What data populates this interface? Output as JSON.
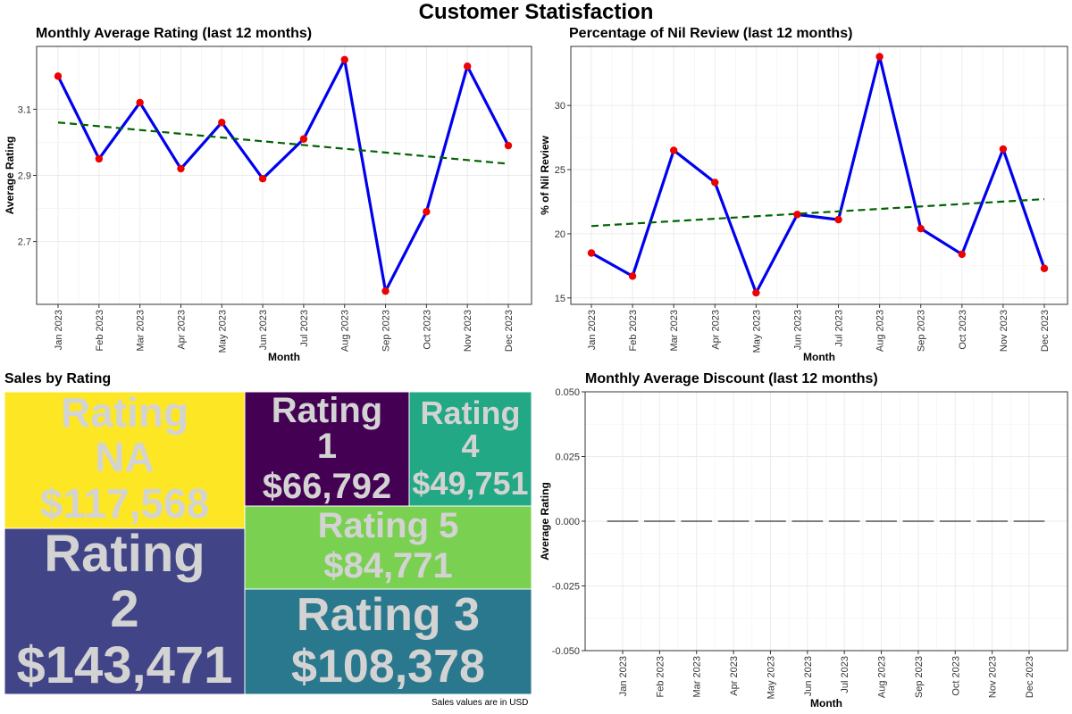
{
  "title": "Customer Statisfaction",
  "treemap_note": "Sales values are in USD",
  "colors": {
    "line": "#0000ee",
    "points": "#ee0000",
    "trend": "#006400",
    "discount": "#333333"
  },
  "chart_data": [
    {
      "id": "rating",
      "type": "line",
      "title": "Monthly Average Rating (last 12 months)",
      "xlabel": "Month",
      "ylabel": "Average Rating",
      "categories": [
        "Jan 2023",
        "Feb 2023",
        "Mar 2023",
        "Apr 2023",
        "May 2023",
        "Jun 2023",
        "Jul 2023",
        "Aug 2023",
        "Sep 2023",
        "Oct 2023",
        "Nov 2023",
        "Dec 2023"
      ],
      "series": [
        {
          "values": [
            3.2,
            2.95,
            3.12,
            2.92,
            3.06,
            2.89,
            3.01,
            3.25,
            2.55,
            2.79,
            3.23,
            2.99
          ]
        }
      ],
      "trend": [
        3.06,
        2.935
      ],
      "ylim": [
        2.51,
        3.29
      ],
      "yticks": [
        2.7,
        2.9,
        3.1
      ],
      "ytick_labels": [
        "2.7",
        "2.9",
        "3.1"
      ],
      "grid": true
    },
    {
      "id": "nil",
      "type": "line",
      "title": "Percentage of Nil Review (last 12 months)",
      "xlabel": "Month",
      "ylabel": "% of Nil Review",
      "categories": [
        "Jan 2023",
        "Feb 2023",
        "Mar 2023",
        "Apr 2023",
        "May 2023",
        "Jun 2023",
        "Jul 2023",
        "Aug 2023",
        "Sep 2023",
        "Oct 2023",
        "Nov 2023",
        "Dec 2023"
      ],
      "series": [
        {
          "values": [
            18.5,
            16.7,
            26.5,
            24.0,
            15.4,
            21.5,
            21.1,
            33.8,
            20.4,
            18.4,
            26.6,
            17.3
          ]
        }
      ],
      "trend": [
        20.6,
        22.7
      ],
      "ylim": [
        14.5,
        34.6
      ],
      "yticks": [
        15,
        20,
        25,
        30
      ],
      "ytick_labels": [
        "15",
        "20",
        "25",
        "30"
      ],
      "grid": true
    },
    {
      "id": "sales",
      "type": "treemap",
      "title": "Sales by Rating",
      "cells": [
        {
          "label": "Rating NA",
          "value": "$117,568",
          "color": "#fde725"
        },
        {
          "label": "Rating 1",
          "value": "$66,792",
          "color": "#440154"
        },
        {
          "label": "Rating 4",
          "value": "$49,751",
          "color": "#22a884"
        },
        {
          "label": "Rating 2",
          "value": "$143,471",
          "color": "#414487"
        },
        {
          "label": "Rating 5",
          "value": "$84,771",
          "color": "#7ad151"
        },
        {
          "label": "Rating 3",
          "value": "$108,378",
          "color": "#2a788e"
        }
      ]
    },
    {
      "id": "discount",
      "type": "line",
      "title": "Monthly Average Discount (last 12 months)",
      "xlabel": "Month",
      "ylabel": "Average Rating",
      "categories": [
        "Jan 2023",
        "Feb 2023",
        "Mar 2023",
        "Apr 2023",
        "May 2023",
        "Jun 2023",
        "Jul 2023",
        "Aug 2023",
        "Sep 2023",
        "Oct 2023",
        "Nov 2023",
        "Dec 2023"
      ],
      "series": [
        {
          "values": [
            0,
            0,
            0,
            0,
            0,
            0,
            0,
            0,
            0,
            0,
            0,
            0
          ]
        }
      ],
      "ylim": [
        -0.05,
        0.05
      ],
      "yticks": [
        -0.05,
        -0.025,
        0,
        0.025,
        0.05
      ],
      "ytick_labels": [
        "-0.050",
        "-0.025",
        "0.000",
        "0.025",
        "0.050"
      ],
      "grid": true
    }
  ]
}
